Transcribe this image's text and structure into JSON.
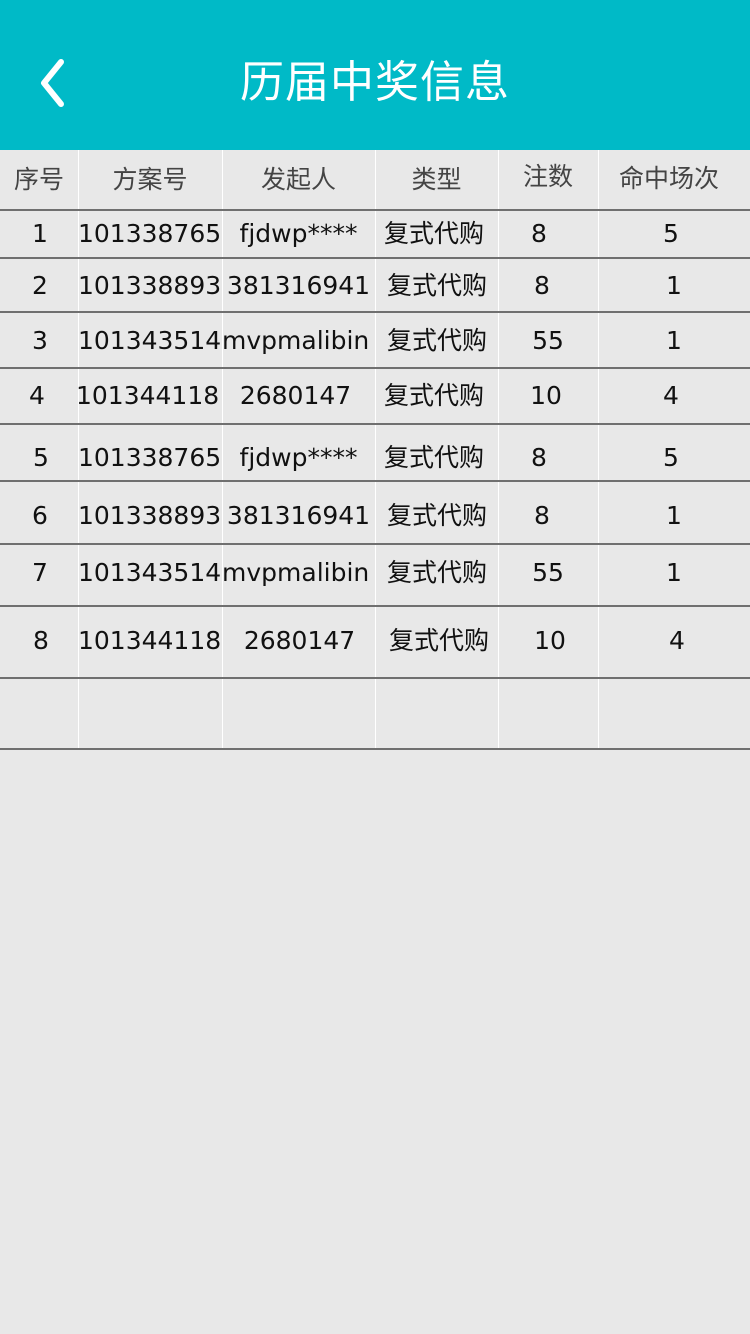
{
  "header": {
    "title": "历届中奖信息",
    "back_icon": "chevron-left-icon",
    "background_color": "#00bac7"
  },
  "table": {
    "columns": [
      "序号",
      "方案号",
      "发起人",
      "类型",
      "注数",
      "命中场次"
    ],
    "rows": [
      {
        "index": "1",
        "plan_no": "101338765",
        "initiator": "fjdwp****",
        "type": "复式代购",
        "bets": "8",
        "hits": "5"
      },
      {
        "index": "2",
        "plan_no": "101338893",
        "initiator": "381316941",
        "type": "复式代购",
        "bets": "8",
        "hits": "1"
      },
      {
        "index": "3",
        "plan_no": "101343514",
        "initiator": "mvpmalibin",
        "type": "复式代购",
        "bets": "55",
        "hits": "1"
      },
      {
        "index": "4",
        "plan_no": "101344118",
        "initiator": "2680147",
        "type": "复式代购",
        "bets": "10",
        "hits": "4"
      },
      {
        "index": "5",
        "plan_no": "101338765",
        "initiator": "fjdwp****",
        "type": "复式代购",
        "bets": "8",
        "hits": "5"
      },
      {
        "index": "6",
        "plan_no": "101338893",
        "initiator": "381316941",
        "type": "复式代购",
        "bets": "8",
        "hits": "1"
      },
      {
        "index": "7",
        "plan_no": "101343514",
        "initiator": "mvpmalibin",
        "type": "复式代购",
        "bets": "55",
        "hits": "1"
      },
      {
        "index": "8",
        "plan_no": "101344118",
        "initiator": "2680147",
        "type": "复式代购",
        "bets": "10",
        "hits": "4"
      }
    ]
  }
}
